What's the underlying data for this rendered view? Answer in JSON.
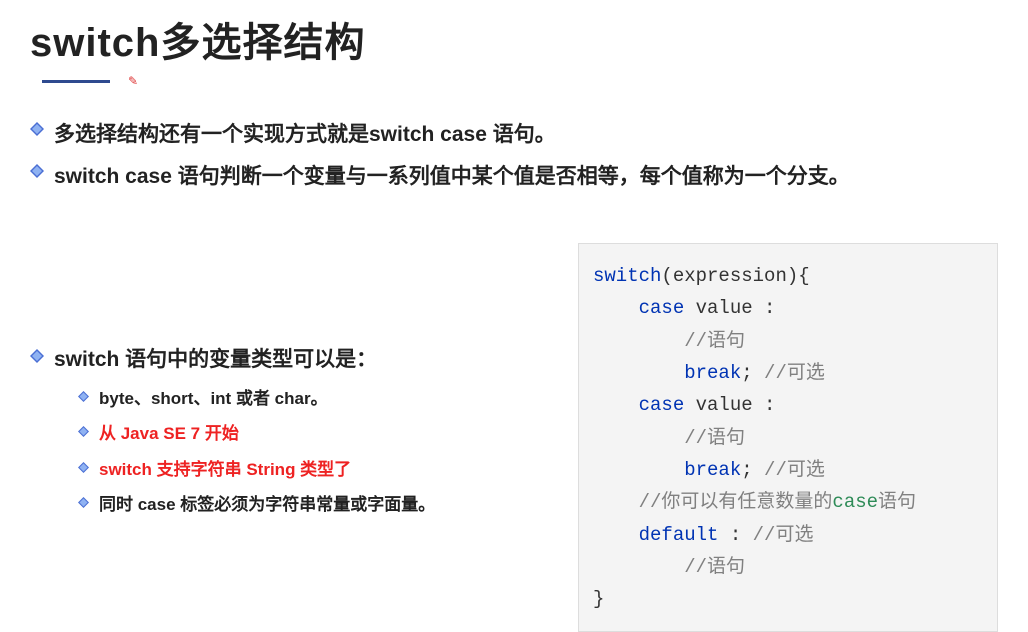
{
  "title": "switch多选择结构",
  "bullets": [
    "多选择结构还有一个实现方式就是switch case 语句。",
    "switch case 语句判断一个变量与一系列值中某个值是否相等，每个值称为一个分支。"
  ],
  "subhead": "switch 语句中的变量类型可以是：",
  "subitems": [
    {
      "text": "byte、short、int 或者 char。",
      "red": false
    },
    {
      "text": "从 Java SE 7 开始",
      "red": true
    },
    {
      "text": "switch 支持字符串 String 类型了",
      "red": true
    },
    {
      "text": "同时 case 标签必须为字符串常量或字面量。",
      "red": false
    }
  ],
  "code": {
    "l1_kw": "switch",
    "l1_rest": "(expression){",
    "l2_kw": "case",
    "l2_rest": " value :",
    "l3_cmt": "//语句",
    "l4_kw": "break",
    "l4_rest": "; ",
    "l4_cmt": "//可选",
    "l5_kw": "case",
    "l5_rest": " value :",
    "l6_cmt": "//语句",
    "l7_kw": "break",
    "l7_rest": "; ",
    "l7_cmt": "//可选",
    "l8_cmt_a": "//你可以有任意数量的",
    "l8_kw": "case",
    "l8_cmt_b": "语句",
    "l9_kw": "default",
    "l9_rest": " : ",
    "l9_cmt": "//可选",
    "l10_cmt": "//语句",
    "l11": "}"
  }
}
